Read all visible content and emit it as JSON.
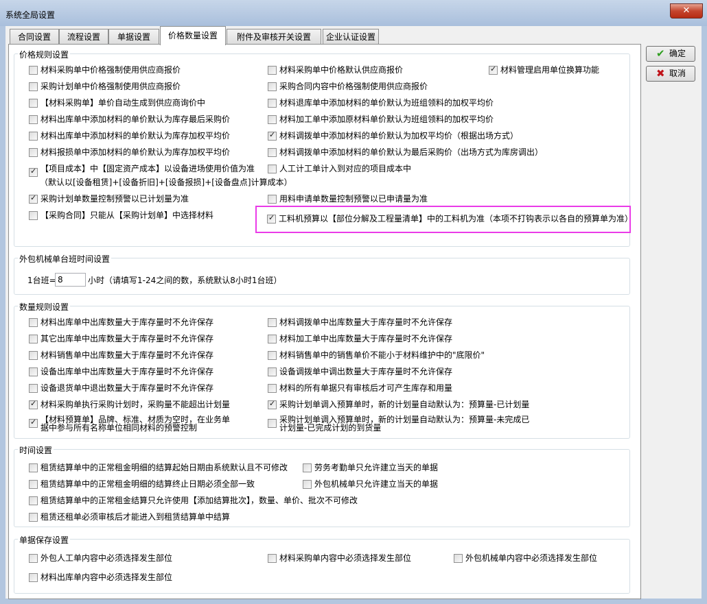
{
  "window": {
    "title": "系统全局设置",
    "close_glyph": "✕"
  },
  "tabs": [
    {
      "label": "合同设置"
    },
    {
      "label": "流程设置"
    },
    {
      "label": "单据设置"
    },
    {
      "label": "价格数量设置"
    },
    {
      "label": "附件及审核开关设置"
    },
    {
      "label": "企业认证设置"
    }
  ],
  "active_tab": "价格数量设置",
  "buttons": {
    "ok": {
      "label": "确定",
      "icon": "check-icon",
      "glyph": "✔",
      "color": "#2f9e1f"
    },
    "cancel": {
      "label": "取消",
      "icon": "close-icon",
      "glyph": "✖",
      "color": "#c0141a"
    }
  },
  "groups": {
    "price": {
      "title": "价格规则设置",
      "items": [
        {
          "label": "材料采购单中价格强制使用供应商报价",
          "checked": false
        },
        {
          "label": "材料采购单中价格默认供应商报价",
          "checked": false
        },
        {
          "label": "材料管理启用单位换算功能",
          "checked": true
        },
        {
          "label": "采购计划单中价格强制使用供应商报价",
          "checked": false
        },
        {
          "label": "采购合同内容中价格强制使用供应商报价",
          "checked": false
        },
        {
          "label": "【材料采购单】单价自动生成到供应商询价中",
          "checked": false
        },
        {
          "label": "材料退库单中添加材料的单价默认为班组领料的加权平均价",
          "checked": false
        },
        {
          "label": "材料出库单中添加材料的单价默认为库存最后采购价",
          "checked": false
        },
        {
          "label": "材料加工单中添加原材料单价默认为班组领料的加权平均价",
          "checked": false
        },
        {
          "label": "材料出库单中添加材料的单价默认为库存加权平均价",
          "checked": false
        },
        {
          "label": "材料调拨单中添加材料的单价默认为加权平均价（根据出场方式）",
          "checked": true
        },
        {
          "label": "材料报损单中添加材料的单价默认为库存加权平均价",
          "checked": false
        },
        {
          "label": "材料调拨单中添加材料的单价默认为最后采购价（出场方式为库房调出）",
          "checked": false
        },
        {
          "label": "【项目成本】中【固定资产成本】以设备进场使用价值为准",
          "label2": "（默认以[设备租赁]+[设备折旧]+[设备报损]+[设备盘点]计算成本）",
          "checked": true
        },
        {
          "label": "人工计工单计入到对应的项目成本中",
          "checked": false
        },
        {
          "label": "采购计划单数量控制预警以已计划量为准",
          "checked": true
        },
        {
          "label": "用料申请单数量控制预警以已申请量为准",
          "checked": false
        },
        {
          "label": "【采购合同】只能从【采购计划单】中选择材料",
          "checked": false
        },
        {
          "label": "工料机预算以【部位分解及工程量清单】中的工料机为准（本项不打钩表示以各自的预算单为准）",
          "checked": true
        }
      ]
    },
    "machine": {
      "title": "外包机械单台班时间设置",
      "prefix": "1台班=",
      "value": "8",
      "suffix": "小时（请填写1-24之间的数，系统默认8小时1台班）"
    },
    "quantity": {
      "title": "数量规则设置",
      "items": [
        {
          "label": "材料出库单中出库数量大于库存量时不允许保存",
          "checked": false
        },
        {
          "label": "材料调拨单中出库数量大于库存量时不允许保存",
          "checked": false
        },
        {
          "label": "其它出库单中出库数量大于库存量时不允许保存",
          "checked": false
        },
        {
          "label": "材料加工单中出库数量大于库存量时不允许保存",
          "checked": false
        },
        {
          "label": "材料销售单中出库数量大于库存量时不允许保存",
          "checked": false
        },
        {
          "label": "材料销售单中的销售单价不能小于材料维护中的\"底限价\"",
          "checked": false
        },
        {
          "label": "设备出库单中出库数量大于库存量时不允许保存",
          "checked": false
        },
        {
          "label": "设备调拨单中调出数量大于库存量时不允许保存",
          "checked": false
        },
        {
          "label": "设备退货单中退出数量大于库存量时不允许保存",
          "checked": false
        },
        {
          "label": "材料的所有单据只有审核后才可产生库存和用量",
          "checked": false
        },
        {
          "label": "材料采购单执行采购计划时，采购量不能超出计划量",
          "checked": true
        },
        {
          "label": "采购计划单调入预算单时，新的计划量自动默认为：预算量-已计划量",
          "checked": true
        },
        {
          "label": "【材料预算单】品牌、标准、材质为空时，在业务单",
          "label2": "据中参与所有名称单位相同材料的预警控制",
          "checked": true
        },
        {
          "label": "采购计划单调入预算单时，新的计划量自动默认为：预算量-未完成已",
          "label2": "计划量-已完成计划的到货量",
          "checked": false
        }
      ]
    },
    "time": {
      "title": "时间设置",
      "items": [
        {
          "label": "租赁结算单中的正常租金明细的结算起始日期由系统默认且不可修改",
          "checked": false
        },
        {
          "label": "劳务考勤单只允许建立当天的单据",
          "checked": false
        },
        {
          "label": "租赁结算单中的正常租金明细的结算终止日期必须全部一致",
          "checked": false
        },
        {
          "label": "外包机械单只允许建立当天的单据",
          "checked": false
        },
        {
          "label": "租赁结算单中的正常租金结算只允许使用【添加结算批次】，数量、单价、批次不可修改",
          "checked": false
        },
        {
          "label": "租赁还租单必须审核后才能进入到租赁结算单中结算",
          "checked": false
        }
      ]
    },
    "save": {
      "title": "单据保存设置",
      "items": [
        {
          "label": "外包人工单内容中必须选择发生部位",
          "checked": false
        },
        {
          "label": "材料采购单内容中必须选择发生部位",
          "checked": false
        },
        {
          "label": "外包机械单内容中必须选择发生部位",
          "checked": false
        },
        {
          "label": "材料出库单内容中必须选择发生部位",
          "checked": false
        }
      ]
    }
  }
}
